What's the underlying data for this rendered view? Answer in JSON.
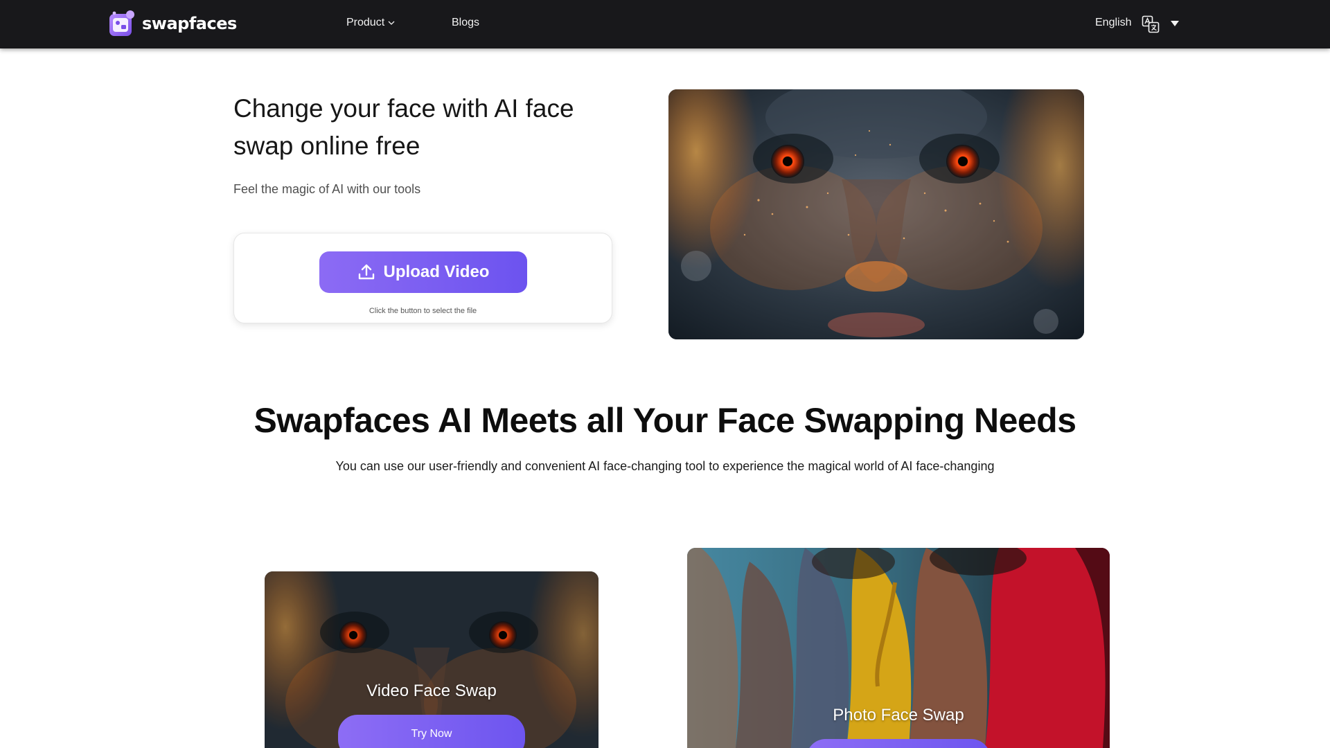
{
  "brand": {
    "name": "swapfaces",
    "accent": "#7a5ff2"
  },
  "nav": {
    "product_label": "Product",
    "blogs_label": "Blogs",
    "language_label": "English",
    "language_icon": "translate-icon",
    "dropdown_icon": "caret-down-icon"
  },
  "hero": {
    "title": "Change your face with AI face swap online free",
    "subtitle": "Feel the magic of AI with our tools",
    "upload_button": "Upload Video",
    "upload_icon": "upload-icon",
    "upload_hint": "Click the button to select the file",
    "image_desc": "glowing-face-portrait"
  },
  "section": {
    "title": "Swapfaces AI Meets all Your Face Swapping Needs",
    "subtitle": "You can use our user-friendly and convenient AI face-changing tool to experience the magical world of AI face-changing"
  },
  "cards": [
    {
      "label": "Video Face Swap",
      "button": "Try Now"
    },
    {
      "label": "Photo Face Swap",
      "button": ""
    }
  ]
}
